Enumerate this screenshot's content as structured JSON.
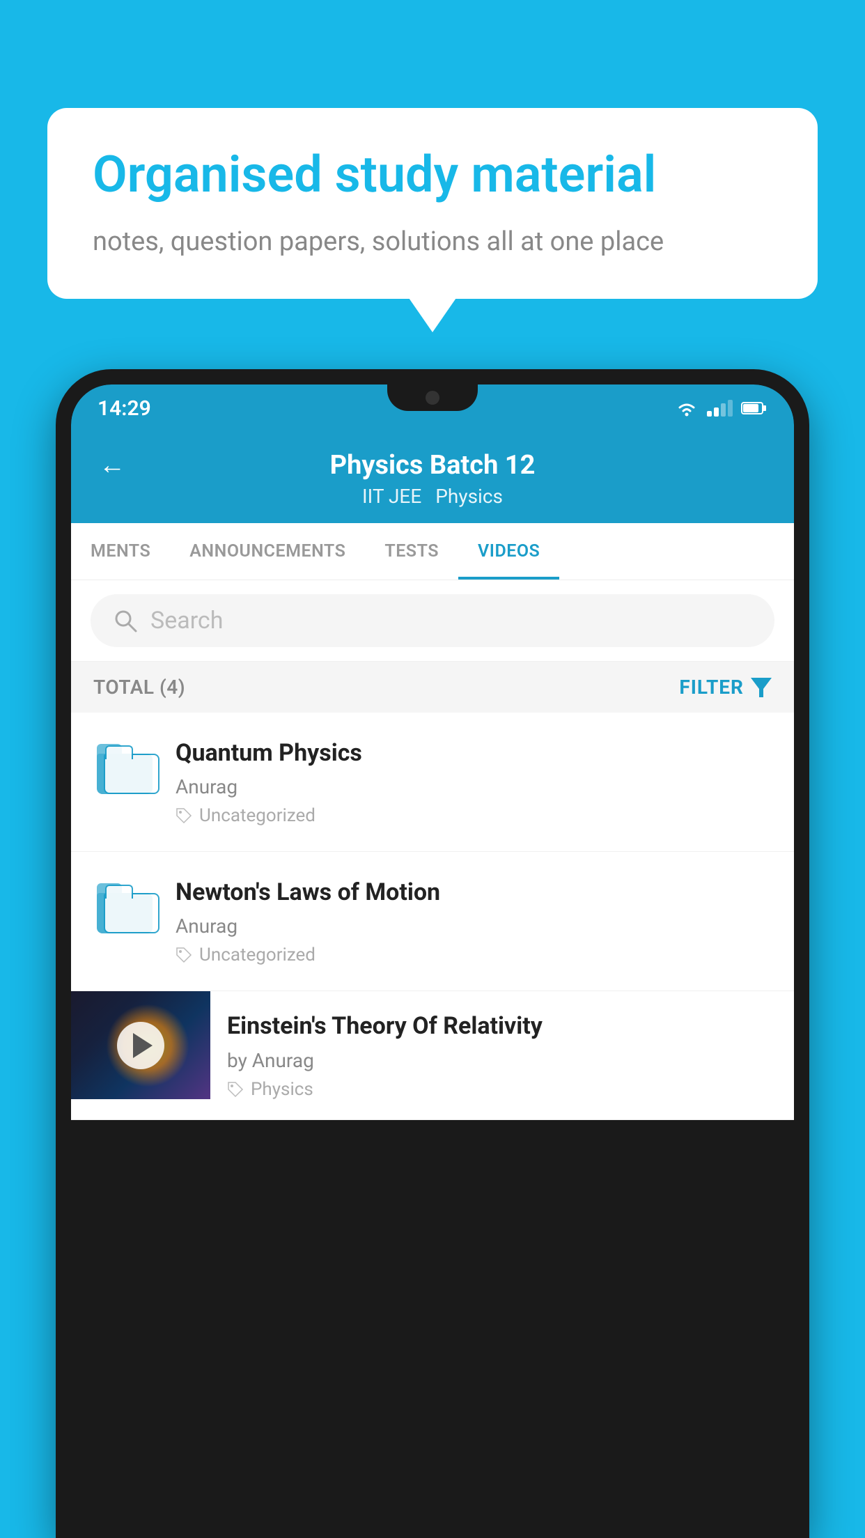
{
  "background": {
    "color": "#18b8e8"
  },
  "speech_bubble": {
    "heading": "Organised study material",
    "subtext": "notes, question papers, solutions all at one place"
  },
  "phone": {
    "status_bar": {
      "time": "14:29"
    },
    "header": {
      "title": "Physics Batch 12",
      "subtitle_left": "IIT JEE",
      "subtitle_right": "Physics",
      "back_label": "←"
    },
    "tabs": [
      {
        "label": "MENTS",
        "active": false
      },
      {
        "label": "ANNOUNCEMENTS",
        "active": false
      },
      {
        "label": "TESTS",
        "active": false
      },
      {
        "label": "VIDEOS",
        "active": true
      }
    ],
    "search": {
      "placeholder": "Search"
    },
    "filter_bar": {
      "total_label": "TOTAL (4)",
      "filter_label": "FILTER"
    },
    "videos": [
      {
        "title": "Quantum Physics",
        "author": "Anurag",
        "tag": "Uncategorized",
        "has_thumbnail": false
      },
      {
        "title": "Newton's Laws of Motion",
        "author": "Anurag",
        "tag": "Uncategorized",
        "has_thumbnail": false
      },
      {
        "title": "Einstein's Theory Of Relativity",
        "author": "by Anurag",
        "tag": "Physics",
        "has_thumbnail": true
      }
    ]
  }
}
